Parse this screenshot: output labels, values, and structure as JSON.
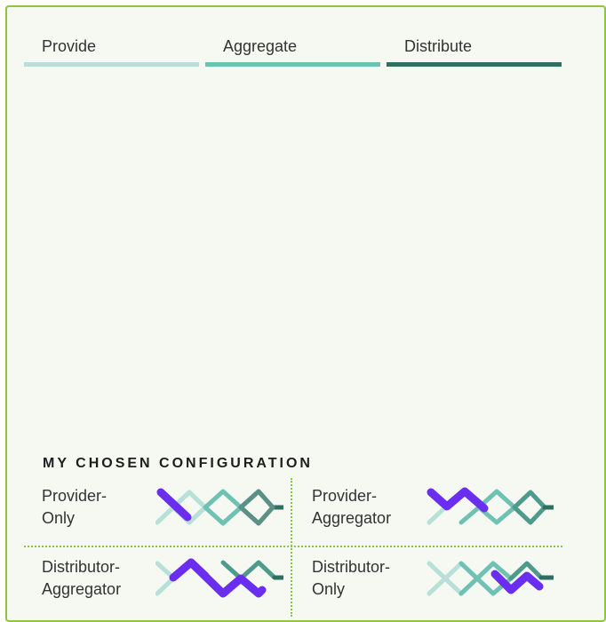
{
  "colors": {
    "border": "#8cc63f",
    "background": "#f6f9f2",
    "provide": "#b7e0d8",
    "aggregate": "#6fc1b3",
    "distribute": "#2e6f61",
    "highlight": "#6a2ef0"
  },
  "tabs": [
    {
      "label": "Provide"
    },
    {
      "label": "Aggregate"
    },
    {
      "label": "Distribute"
    }
  ],
  "configuration": {
    "title": "MY CHOSEN CONFIGURATION",
    "options": [
      {
        "label": "Provider-\nOnly",
        "icon": "provider-only-icon"
      },
      {
        "label": "Provider-\nAggregator",
        "icon": "provider-aggregator-icon"
      },
      {
        "label": "Distributor-\nAggregator",
        "icon": "distributor-aggregator-icon"
      },
      {
        "label": "Distributor-\nOnly",
        "icon": "distributor-only-icon"
      }
    ]
  }
}
